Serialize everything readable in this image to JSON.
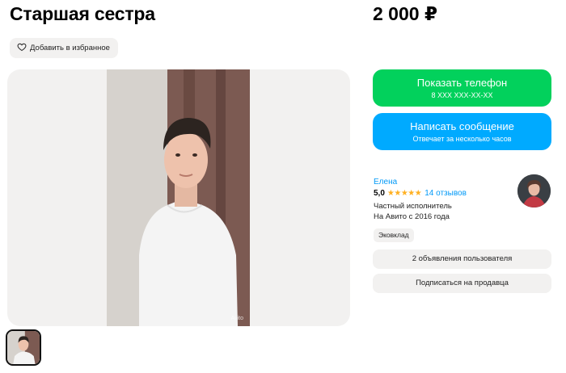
{
  "listing": {
    "title": "Старшая сестра",
    "price": "2 000 ₽",
    "favorite_label": "Добавить в избранное",
    "watermark": "Avito"
  },
  "contact": {
    "show_phone_label": "Показать телефон",
    "phone_mask": "8 XXX XXX-XX-XX",
    "message_label": "Написать сообщение",
    "response_time": "Отвечает за несколько часов"
  },
  "seller": {
    "name": "Елена",
    "rating": "5,0",
    "stars": 5,
    "reviews": "14 отзывов",
    "type": "Частный исполнитель",
    "since": "На Авито с 2016 года",
    "tag": "Эковклад",
    "ads_label": "2 объявления пользователя",
    "subscribe_label": "Подписаться на продавца"
  },
  "colors": {
    "green": "#02d15c",
    "blue": "#00aaff",
    "link": "#0099f7",
    "star": "#ffb021",
    "gray_bg": "#f2f1f0"
  },
  "icons": [
    "heart-icon",
    "star-icon"
  ]
}
